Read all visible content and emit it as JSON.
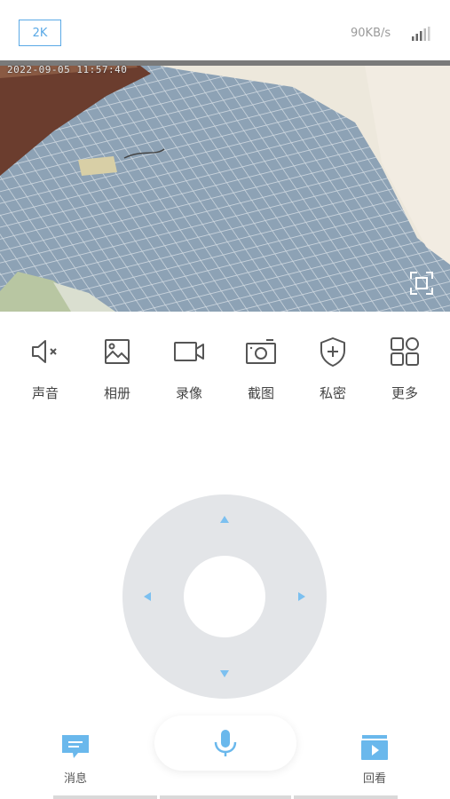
{
  "header": {
    "quality_label": "2K",
    "speed": "90KB/s",
    "signal_icon": "signal-bars-icon"
  },
  "video": {
    "timestamp": "2022-09-05 11:57:40",
    "fullscreen_icon": "fullscreen-icon"
  },
  "tools": [
    {
      "label": "声音",
      "icon": "speaker-muted-icon"
    },
    {
      "label": "相册",
      "icon": "photo-album-icon"
    },
    {
      "label": "录像",
      "icon": "video-record-icon"
    },
    {
      "label": "截图",
      "icon": "camera-screenshot-icon"
    },
    {
      "label": "私密",
      "icon": "shield-plus-icon"
    },
    {
      "label": "更多",
      "icon": "grid-more-icon"
    }
  ],
  "ptz": {
    "icons": [
      "arrow-up-icon",
      "arrow-down-icon",
      "arrow-left-icon",
      "arrow-right-icon"
    ]
  },
  "bottom": {
    "messages_label": "消息",
    "playback_label": "回看",
    "mic_icon": "microphone-icon"
  },
  "colors": {
    "accent": "#5aa9e6",
    "icon_gray": "#555555",
    "joystick_bg": "#e3e5e8",
    "bottom_icon": "#6ab8ec"
  }
}
